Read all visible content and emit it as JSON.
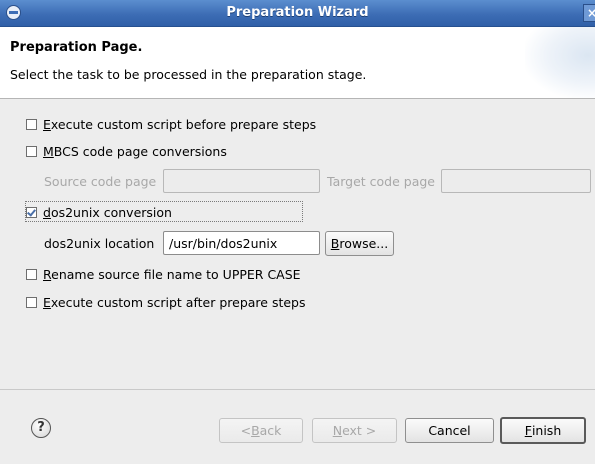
{
  "window": {
    "title": "Preparation Wizard",
    "close_glyph": "×"
  },
  "header": {
    "title": "Preparation Page.",
    "description": "Select the task to be processed in the preparation stage."
  },
  "options": {
    "custom_before": {
      "mnemonic": "E",
      "rest": "xecute custom script before prepare steps",
      "checked": false
    },
    "mbcs": {
      "mnemonic": "M",
      "rest": "BCS code page conversions",
      "checked": false
    },
    "source_code_page_label": "Source code page",
    "source_code_page_value": "",
    "target_code_page_label": "Target code page",
    "target_code_page_value": "",
    "dos2unix": {
      "mnemonic": "d",
      "rest": "os2unix conversion",
      "checked": true
    },
    "dos2unix_location_label": "dos2unix location",
    "dos2unix_location_value": "/usr/bin/dos2unix",
    "browse": {
      "mnemonic": "B",
      "rest": "rowse..."
    },
    "rename_upper": {
      "mnemonic": "R",
      "rest": "ename source file name to UPPER CASE",
      "checked": false
    },
    "custom_after": {
      "mnemonic": "E",
      "rest": "xecute custom script after prepare steps",
      "checked": false
    }
  },
  "footer": {
    "help_glyph": "?",
    "back": {
      "prefix": "< ",
      "mnemonic": "B",
      "rest": "ack"
    },
    "next": {
      "mnemonic": "N",
      "rest": "ext >"
    },
    "cancel": "Cancel",
    "finish": {
      "mnemonic": "F",
      "rest": "inish"
    }
  },
  "icons": {
    "window_menu": "window-menu-icon",
    "close": "close-icon",
    "help": "help-icon"
  }
}
